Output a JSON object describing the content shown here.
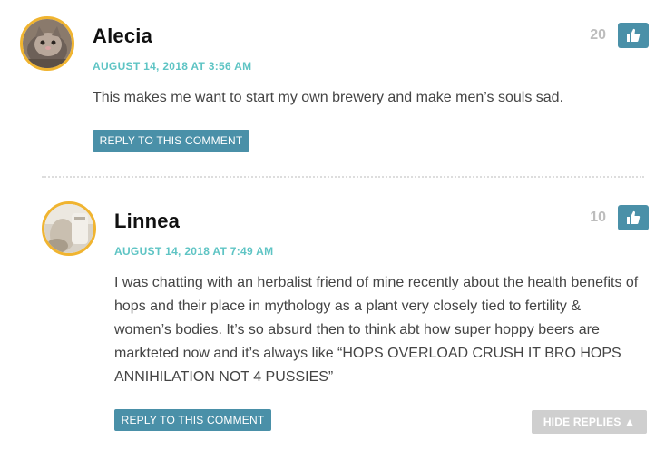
{
  "comments": [
    {
      "author": "Alecia",
      "date": "AUGUST 14, 2018 AT 3:56 AM",
      "votes": "20",
      "text": "This makes me want to start my own brewery and make men’s souls sad.",
      "reply_label": "REPLY TO THIS COMMENT"
    },
    {
      "author": "Linnea",
      "date": "AUGUST 14, 2018 AT 7:49 AM",
      "votes": "10",
      "text": "I was chatting with an herbalist friend of mine recently about the health benefits of hops and their place in mythology as a plant very closely tied to fertility & women’s bodies. It’s so absurd then to think abt how super hoppy beers are markteted now and it’s always like “HOPS OVERLOAD CRUSH IT BRO HOPS ANNIHILATION NOT 4 PUSSIES”",
      "reply_label": "REPLY TO THIS COMMENT"
    }
  ],
  "hide_replies": {
    "label": "HIDE REPLIES",
    "arrow": "▲"
  },
  "colors": {
    "accent": "#4a90a8",
    "date": "#5ec4c4",
    "avatar_ring": "#f0b430",
    "vote_count": "#bdbdbd"
  },
  "icons": {
    "like": "thumbs-up-icon"
  }
}
